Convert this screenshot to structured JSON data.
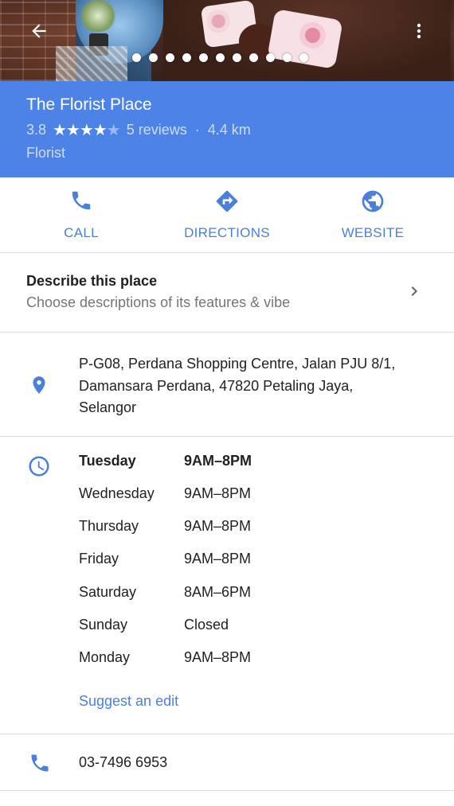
{
  "header": {
    "back_icon": "arrow-back-icon",
    "more_icon": "more-vert-icon",
    "photo_count": 11
  },
  "place": {
    "name": "The Florist Place",
    "rating": "3.8",
    "rating_value": 3.8,
    "stars_glyphs": {
      "full": "★",
      "empty": "★"
    },
    "reviews": "5 reviews",
    "separator": "·",
    "distance": "4.4 km",
    "category": "Florist"
  },
  "actions": {
    "call": {
      "label": "CALL",
      "icon": "phone-icon"
    },
    "directions": {
      "label": "DIRECTIONS",
      "icon": "directions-icon"
    },
    "website": {
      "label": "WEBSITE",
      "icon": "globe-icon"
    }
  },
  "describe": {
    "title": "Describe this place",
    "subtitle": "Choose descriptions of its features & vibe",
    "icon": "chevron-right-icon"
  },
  "address": {
    "icon": "location-pin-icon",
    "lines": [
      "P-G08, Perdana Shopping Centre, Jalan PJU 8/1,",
      "Damansara Perdana, 47820 Petaling Jaya,",
      "Selangor"
    ]
  },
  "hours": {
    "icon": "clock-icon",
    "days": [
      {
        "day": "Tuesday",
        "time": "9AM–8PM"
      },
      {
        "day": "Wednesday",
        "time": "9AM–8PM"
      },
      {
        "day": "Thursday",
        "time": "9AM–8PM"
      },
      {
        "day": "Friday",
        "time": "9AM–8PM"
      },
      {
        "day": "Saturday",
        "time": "8AM–6PM"
      },
      {
        "day": "Sunday",
        "time": "Closed"
      },
      {
        "day": "Monday",
        "time": "9AM–8PM"
      }
    ],
    "suggest_edit": "Suggest an edit"
  },
  "phone": {
    "icon": "phone-icon",
    "number": "03-7496 6953"
  },
  "colors": {
    "banner": "#4d83e6",
    "accent": "#4a7fdb",
    "divider": "#dcdcdc"
  }
}
